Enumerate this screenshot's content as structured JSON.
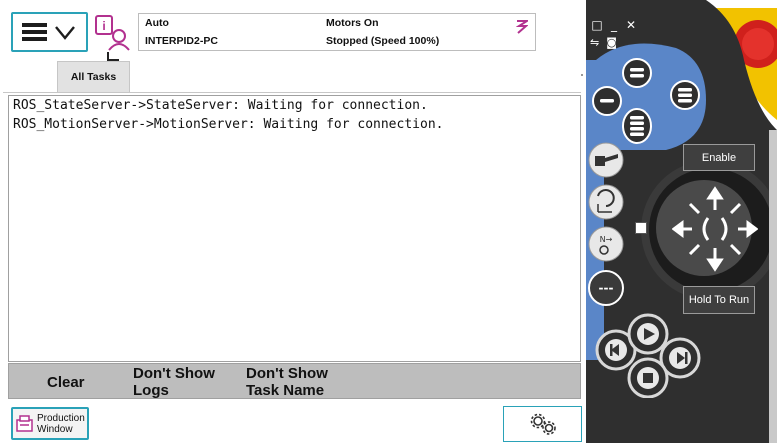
{
  "status": {
    "mode": "Auto",
    "system": "INTERPID2-PC",
    "motors": "Motors On",
    "state": "Stopped (Speed 100%)"
  },
  "tabs": [
    {
      "label": "All Tasks"
    }
  ],
  "log": {
    "lines": [
      "ROS_StateServer->StateServer: Waiting for connection.",
      "ROS_MotionServer->MotionServer: Waiting for connection."
    ]
  },
  "commands": {
    "clear": "Clear",
    "dont_show_logs": "Don't Show\nLogs",
    "dont_show_task_name": "Don't Show\nTask Name"
  },
  "taskbar": {
    "production_window": "Production\nWindow"
  },
  "pendant": {
    "enable": "Enable",
    "hold_to_run": "Hold To Run",
    "window_controls": [
      "□",
      "_",
      "✕"
    ],
    "window_controls_2": [
      "⇋",
      "◙"
    ],
    "more_label": "---"
  },
  "colors": {
    "accent": "#2aa2b8",
    "pendant_body": "#2f2f2f",
    "pendant_blue": "#5a86c8",
    "pendant_yellow": "#f2c200",
    "estop_red": "#d0201c"
  }
}
